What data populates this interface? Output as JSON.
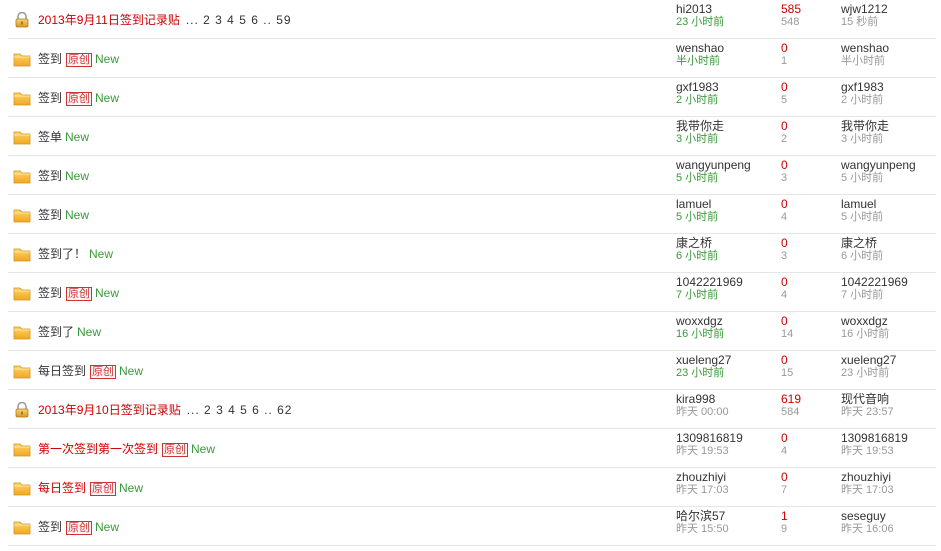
{
  "threads": [
    {
      "icon": "lock-icon",
      "title": "2013年9月11日签到记录贴",
      "title_style": "red",
      "pages": "... 2 3 4 5 6 .. 59",
      "original": false,
      "new": false,
      "author": "hi2013",
      "author_time": "23 小时前",
      "author_time_style": "green",
      "replies": "585",
      "views": "548",
      "last_user": "wjw1212",
      "last_time": "15 秒前"
    },
    {
      "icon": "folder-icon",
      "title": "签到",
      "title_style": "normal",
      "original": true,
      "new": true,
      "author": "wenshao",
      "author_time": "半小时前",
      "author_time_style": "green",
      "replies": "0",
      "views": "1",
      "last_user": "wenshao",
      "last_time": "半小时前"
    },
    {
      "icon": "folder-icon",
      "title": "签到",
      "title_style": "normal",
      "original": true,
      "new": true,
      "author": "gxf1983",
      "author_time": "2 小时前",
      "author_time_style": "green",
      "replies": "0",
      "views": "5",
      "last_user": "gxf1983",
      "last_time": "2 小时前"
    },
    {
      "icon": "folder-icon",
      "title": "签单",
      "title_style": "normal",
      "original": false,
      "new": true,
      "author": "我带你走",
      "author_time": "3 小时前",
      "author_time_style": "green",
      "replies": "0",
      "views": "2",
      "last_user": "我带你走",
      "last_time": "3 小时前"
    },
    {
      "icon": "folder-icon",
      "title": "签到",
      "title_style": "normal",
      "original": false,
      "new": true,
      "author": "wangyunpeng",
      "author_time": "5 小时前",
      "author_time_style": "green",
      "replies": "0",
      "views": "3",
      "last_user": "wangyunpeng",
      "last_time": "5 小时前"
    },
    {
      "icon": "folder-icon",
      "title": "签到",
      "title_style": "normal",
      "original": false,
      "new": true,
      "author": "lamuel",
      "author_time": "5 小时前",
      "author_time_style": "green",
      "replies": "0",
      "views": "4",
      "last_user": "lamuel",
      "last_time": "5 小时前"
    },
    {
      "icon": "folder-icon",
      "title": "签到了！",
      "title_style": "normal",
      "original": false,
      "new": true,
      "author": "康之桥",
      "author_time": "6 小时前",
      "author_time_style": "green",
      "replies": "0",
      "views": "3",
      "last_user": "康之桥",
      "last_time": "6 小时前"
    },
    {
      "icon": "folder-icon",
      "title": "签到",
      "title_style": "normal",
      "original": true,
      "new": true,
      "author": "1042221969",
      "author_time": "7 小时前",
      "author_time_style": "green",
      "replies": "0",
      "views": "4",
      "last_user": "1042221969",
      "last_time": "7 小时前"
    },
    {
      "icon": "folder-icon",
      "title": "签到了",
      "title_style": "normal",
      "original": false,
      "new": true,
      "author": "woxxdgz",
      "author_time": "16 小时前",
      "author_time_style": "green",
      "replies": "0",
      "views": "14",
      "last_user": "woxxdgz",
      "last_time": "16 小时前"
    },
    {
      "icon": "folder-icon",
      "title": "每日签到",
      "title_style": "normal",
      "original": true,
      "new": true,
      "author": "xueleng27",
      "author_time": "23 小时前",
      "author_time_style": "green",
      "replies": "0",
      "views": "15",
      "last_user": "xueleng27",
      "last_time": "23 小时前"
    },
    {
      "icon": "lock-icon",
      "title": "2013年9月10日签到记录贴",
      "title_style": "red",
      "pages": "... 2 3 4 5 6 .. 62",
      "original": false,
      "new": false,
      "author": "kira998",
      "author_time": "昨天 00:00",
      "author_time_style": "grey",
      "replies": "619",
      "views": "584",
      "last_user": "现代音响",
      "last_time": "昨天 23:57"
    },
    {
      "icon": "folder-icon",
      "title": "第一次签到第一次签到",
      "title_style": "red",
      "original": true,
      "new": true,
      "author": "1309816819",
      "author_time": "昨天 19:53",
      "author_time_style": "grey",
      "replies": "0",
      "views": "4",
      "last_user": "1309816819",
      "last_time": "昨天 19:53"
    },
    {
      "icon": "folder-icon",
      "title": "每日签到",
      "title_style": "red",
      "original": true,
      "new": true,
      "author": "zhouzhiyi",
      "author_time": "昨天 17:03",
      "author_time_style": "grey",
      "replies": "0",
      "views": "7",
      "last_user": "zhouzhiyi",
      "last_time": "昨天 17:03"
    },
    {
      "icon": "folder-icon",
      "title": "签到",
      "title_style": "normal",
      "original": true,
      "new": true,
      "author": "哈尔滨57",
      "author_time": "昨天 15:50",
      "author_time_style": "grey",
      "replies": "1",
      "views": "9",
      "last_user": "seseguy",
      "last_time": "昨天 16:06"
    }
  ],
  "labels": {
    "original": "原创",
    "new": "New"
  }
}
